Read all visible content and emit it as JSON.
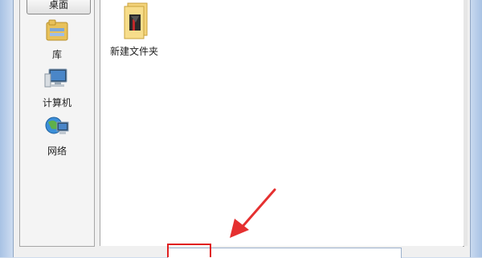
{
  "sidebar": {
    "items": [
      {
        "label": "桌面",
        "icon": "desktop-icon"
      },
      {
        "label": "库",
        "icon": "library-icon"
      },
      {
        "label": "计算机",
        "icon": "computer-icon"
      },
      {
        "label": "网络",
        "icon": "network-icon"
      }
    ]
  },
  "content": {
    "items": [
      {
        "label": "新建文件夹",
        "icon": "folder-icon"
      }
    ]
  },
  "annotation": {
    "arrow_color": "#e53030",
    "box_color": "#e02020"
  }
}
